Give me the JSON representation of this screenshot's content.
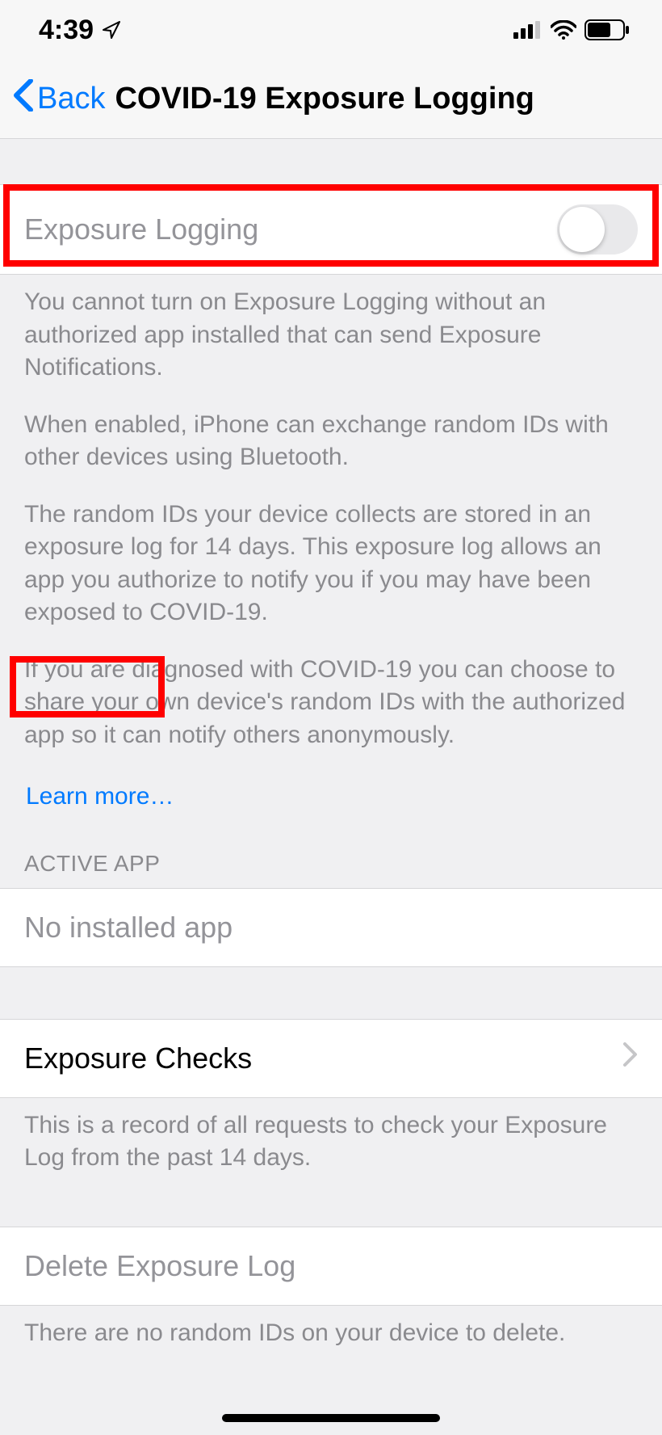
{
  "status": {
    "time": "4:39"
  },
  "nav": {
    "back_label": "Back",
    "title": "COVID-19 Exposure Logging"
  },
  "section1": {
    "toggle_label": "Exposure Logging",
    "toggle_on": false,
    "p1": "You cannot turn on Exposure Logging without an authorized app installed that can send Exposure Notifications.",
    "p2": "When enabled, iPhone can exchange random IDs with other devices using Bluetooth.",
    "p3": "The random IDs your device collects are stored in an exposure log for 14 days. This exposure log allows an app you authorize to notify you if you may have been exposed to COVID-19.",
    "p4": "If you are diagnosed with COVID-19 you can choose to share your own device's random IDs with the authorized app so it can notify others anonymously.",
    "learn_more": "Learn more…"
  },
  "section2": {
    "header": "ACTIVE APP",
    "value": "No installed app"
  },
  "section3": {
    "label": "Exposure Checks",
    "footer": "This is a record of all requests to check your Exposure Log from the past 14 days."
  },
  "section4": {
    "label": "Delete Exposure Log",
    "footer": "There are no random IDs on your device to delete."
  }
}
